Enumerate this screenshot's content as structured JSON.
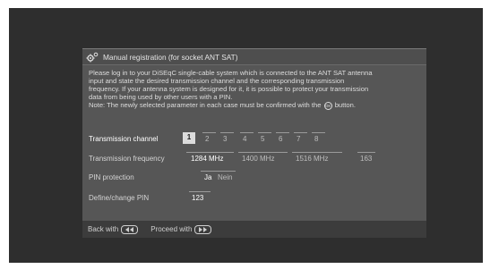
{
  "dialog": {
    "title": "Manual registration (for socket ANT SAT)",
    "title_icon": "gear-icon",
    "description_lines": [
      "Please log in to your DiSEqC single-cable system which is connected to the ANT SAT antenna",
      "input and state the desired transmission channel and the corresponding transmission",
      "frequency. If your antenna system is designed for it, it is possible to protect your transmission",
      "data from being used by other users with a PIN."
    ],
    "note_before": "Note: The newly selected parameter in each case must be confirmed with the",
    "note_icon_text": "OK",
    "note_after": "button.",
    "rows": {
      "channel": {
        "label": "Transmission channel",
        "options": [
          "1",
          "2",
          "3",
          "4",
          "5",
          "6",
          "7",
          "8"
        ],
        "selected": "1"
      },
      "frequency": {
        "label": "Transmission frequency",
        "options": [
          "1284 MHz",
          "1400 MHz",
          "1516 MHz",
          "163"
        ],
        "selected": "1284 MHz"
      },
      "pin_protection": {
        "label": "PIN protection",
        "options": [
          "Ja",
          "Nein"
        ],
        "selected": "Ja"
      },
      "pin": {
        "label": "Define/change PIN",
        "value": "123"
      }
    },
    "footer": {
      "back_label": "Back with",
      "back_icon": "rewind-button-icon",
      "proceed_label": "Proceed with",
      "proceed_icon": "fast-forward-button-icon"
    }
  },
  "colors": {
    "screen_background": "#2e2e2e",
    "dialog_background": "#565656",
    "footer_background": "#3c3c3c",
    "highlight": "#dcdcdc"
  }
}
